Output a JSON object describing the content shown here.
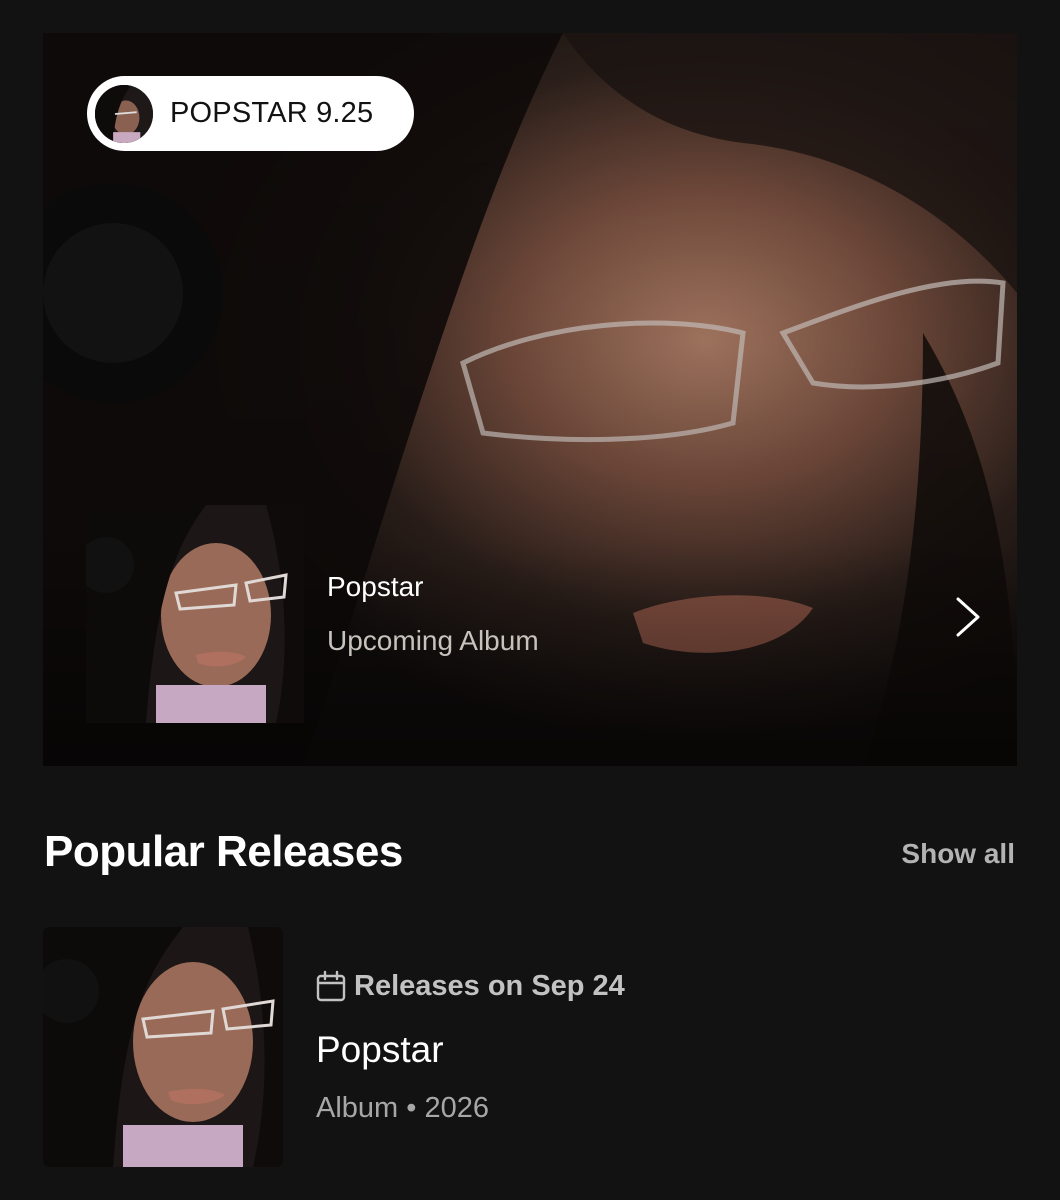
{
  "hero": {
    "countdown_pill": {
      "label": "POPSTAR 9.25"
    },
    "release": {
      "title": "Popstar",
      "subtitle": "Upcoming Album"
    },
    "chevron_icon": "chevron-right-icon"
  },
  "popular_releases": {
    "title": "Popular Releases",
    "show_all_label": "Show all",
    "items": [
      {
        "date_icon": "calendar-icon",
        "date_label": "Releases on Sep 24",
        "title": "Popstar",
        "meta": "Album • 2026"
      }
    ]
  },
  "colors": {
    "background": "#121212",
    "text_primary": "#ffffff",
    "text_secondary": "#b3b3b3"
  }
}
